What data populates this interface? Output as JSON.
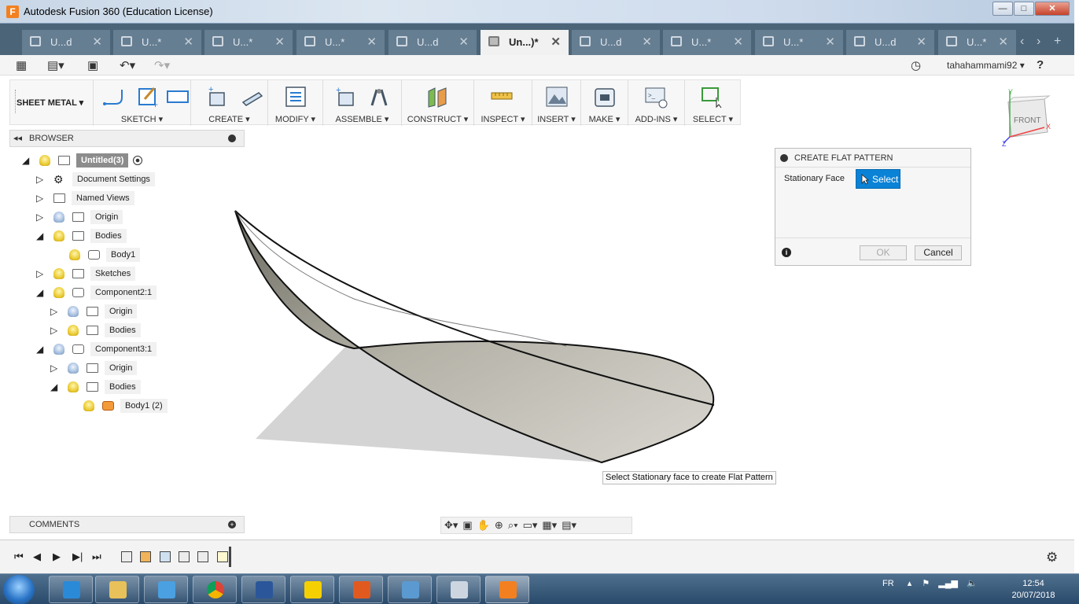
{
  "window": {
    "title": "Autodesk Fusion 360 (Education License)",
    "minimize": "—",
    "maximize": "□",
    "close": "✕"
  },
  "tabs": [
    {
      "label": "U...d",
      "close": "✕"
    },
    {
      "label": "U...*",
      "close": "✕"
    },
    {
      "label": "U...*",
      "close": "✕"
    },
    {
      "label": "U...*",
      "close": "✕"
    },
    {
      "label": "U...d",
      "close": "✕"
    },
    {
      "label": "Un...)*",
      "close": "✕"
    },
    {
      "label": "U...d",
      "close": "✕"
    },
    {
      "label": "U...*",
      "close": "✕"
    },
    {
      "label": "U...*",
      "close": "✕"
    },
    {
      "label": "U...d",
      "close": "✕"
    },
    {
      "label": "U...*",
      "close": "✕"
    }
  ],
  "appbar": {
    "user": "tahahammami92 ▾",
    "help": "?"
  },
  "toolbar": {
    "workspace": "SHEET METAL ▾",
    "groups": [
      "SKETCH ▾",
      "CREATE ▾",
      "MODIFY ▾",
      "ASSEMBLE ▾",
      "CONSTRUCT ▾",
      "INSPECT ▾",
      "INSERT ▾",
      "MAKE ▾",
      "ADD-INS ▾",
      "SELECT ▾"
    ]
  },
  "browser": {
    "title": "BROWSER",
    "items": [
      {
        "label": "Untitled(3)"
      },
      {
        "label": "Document Settings"
      },
      {
        "label": "Named Views"
      },
      {
        "label": "Origin"
      },
      {
        "label": "Bodies"
      },
      {
        "label": "Body1"
      },
      {
        "label": "Sketches"
      },
      {
        "label": "Component2:1"
      },
      {
        "label": "Origin"
      },
      {
        "label": "Bodies"
      },
      {
        "label": "Component3:1"
      },
      {
        "label": "Origin"
      },
      {
        "label": "Bodies"
      },
      {
        "label": "Body1 (2)"
      }
    ]
  },
  "viewcube": {
    "face": "FRONT",
    "axis_x": "X",
    "axis_y": "Y",
    "axis_z": "Z"
  },
  "dialog": {
    "title": "CREATE FLAT PATTERN",
    "stationary_face_label": "Stationary Face",
    "select_label": "Select",
    "ok": "OK",
    "cancel": "Cancel",
    "info": "i"
  },
  "tooltip": "Select Stationary face to create Flat Pattern",
  "comments": {
    "title": "COMMENTS"
  },
  "taskbar": {
    "lang": "FR",
    "time": "12:54",
    "date": "20/07/2018"
  },
  "colors": {
    "accent": "#0a82d6",
    "tabbar": "#4b6478",
    "canvas": "#ffffff"
  }
}
